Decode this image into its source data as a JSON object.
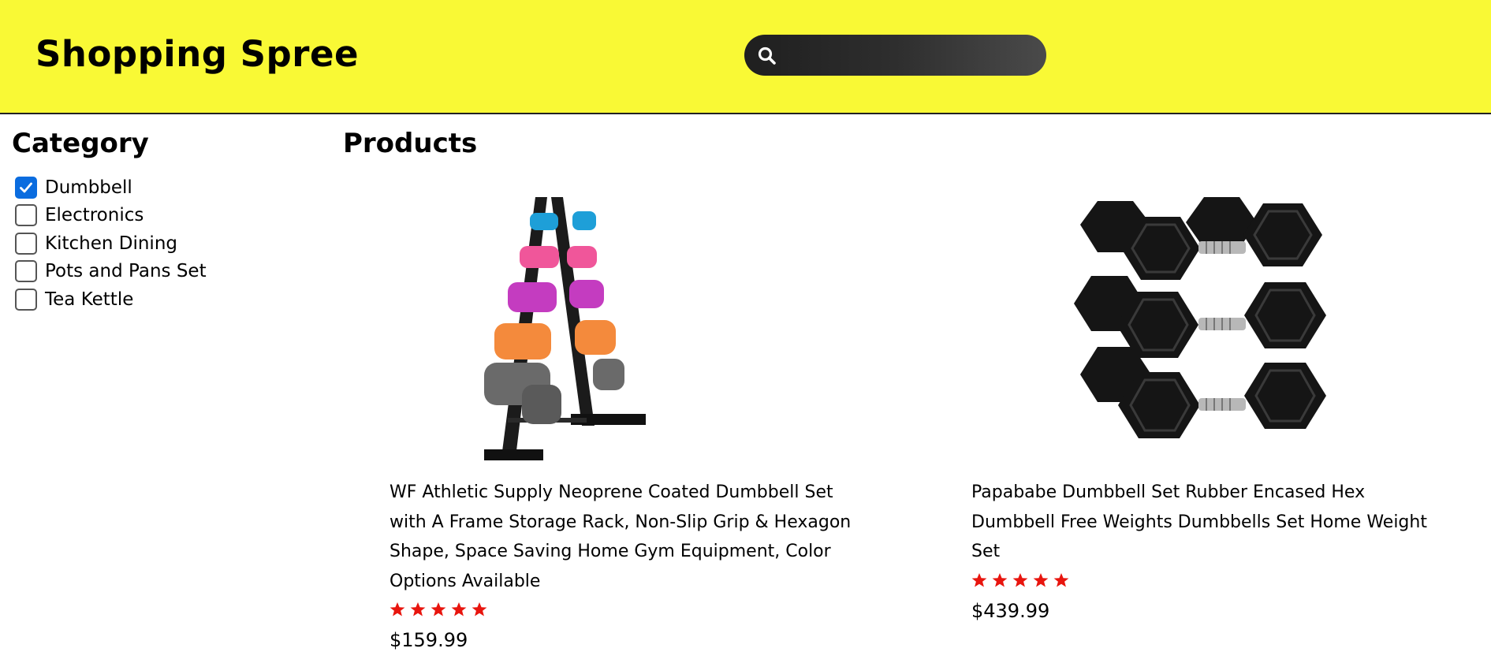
{
  "header": {
    "brand": "Shopping Spree",
    "search": {
      "icon": "search-icon",
      "value": "",
      "placeholder": ""
    }
  },
  "sidebar": {
    "title": "Category",
    "categories": [
      {
        "label": "Dumbbell",
        "checked": true
      },
      {
        "label": "Electronics",
        "checked": false
      },
      {
        "label": "Kitchen Dining",
        "checked": false
      },
      {
        "label": "Pots and Pans Set",
        "checked": false
      },
      {
        "label": "Tea Kettle",
        "checked": false
      }
    ]
  },
  "main": {
    "title": "Products",
    "products": [
      {
        "name": "WF Athletic Supply Neoprene Coated Dumbbell Set with A Frame Storage Rack, Non-Slip Grip & Hexagon Shape, Space Saving Home Gym Equipment, Color Options Available",
        "rating": 5,
        "price": "$159.99",
        "image": "neoprene-dumbbell-rack-photo"
      },
      {
        "name": "Papababe Dumbbell Set Rubber Encased Hex Dumbbell Free Weights Dumbbells Set Home Weight Set",
        "rating": 5,
        "price": "$439.99",
        "image": "hex-dumbbell-set-photo"
      }
    ]
  },
  "colors": {
    "header_bg": "#f9f935",
    "checkbox_checked": "#0a6cdf",
    "star": "#e8150e"
  }
}
